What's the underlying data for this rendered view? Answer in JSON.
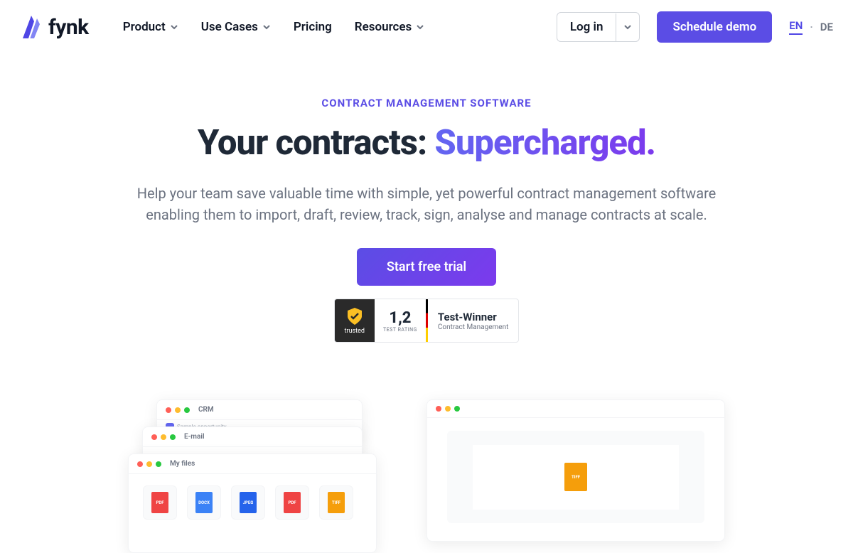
{
  "brand": "fynk",
  "nav": {
    "product": "Product",
    "usecases": "Use Cases",
    "pricing": "Pricing",
    "resources": "Resources"
  },
  "header": {
    "login": "Log in",
    "schedule": "Schedule demo",
    "lang_en": "EN",
    "lang_de": "DE"
  },
  "hero": {
    "eyebrow": "CONTRACT MANAGEMENT SOFTWARE",
    "headline_plain": "Your contracts: ",
    "headline_accent": "Supercharged.",
    "subhead": "Help your team save valuable time with simple, yet powerful contract management software enabling them to import, draft, review, track, sign, analyse and manage contracts at scale.",
    "cta": "Start free trial"
  },
  "badge": {
    "trusted": "trusted",
    "score": "1,2",
    "score_label": "TEST RATING",
    "winner": "Test-Winner",
    "category": "Contract Management"
  },
  "windows": {
    "crm": "CRM",
    "sample": "Sample opportunity",
    "email": "E-mail",
    "files": "My files",
    "file_types": [
      "PDF",
      "DOCX",
      "JPEG",
      "PDF",
      "TIFF"
    ],
    "drop_file": "TIFF"
  }
}
